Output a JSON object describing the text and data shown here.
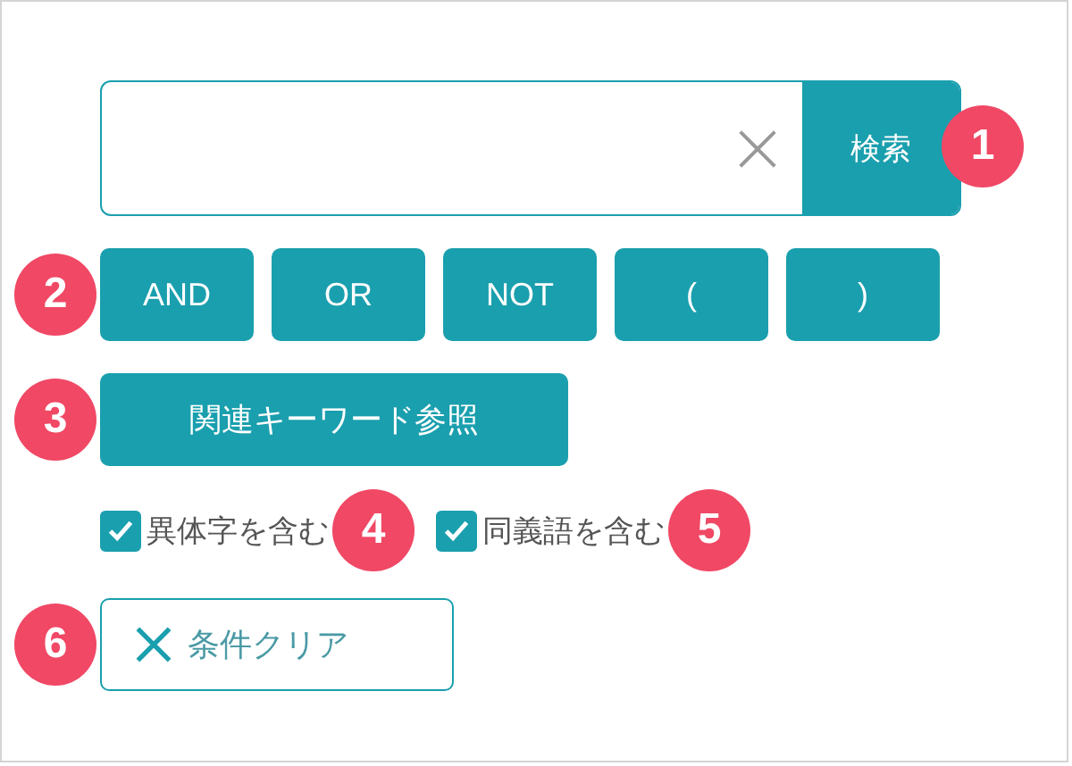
{
  "search": {
    "value_clear": "×",
    "button": "検索",
    "callout": "1"
  },
  "operators": {
    "callout": "2",
    "buttons": [
      "AND",
      "OR",
      "NOT",
      "(",
      ")"
    ]
  },
  "related_keywords": {
    "label": "関連キーワード参照",
    "callout": "3"
  },
  "options": [
    {
      "label": "異体字を含む",
      "checked": true,
      "callout": "4"
    },
    {
      "label": "同義語を含む",
      "checked": true,
      "callout": "5"
    }
  ],
  "clear_button": {
    "label": "条件クリア",
    "callout": "6"
  }
}
